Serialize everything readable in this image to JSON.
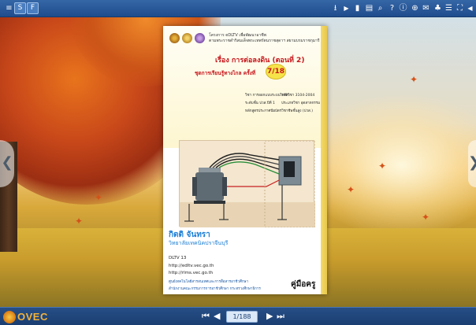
{
  "toolbar": {
    "left_buttons": [
      {
        "icon": "menu-icon",
        "glyph": "≡"
      },
      {
        "icon": "table-of-contents-icon",
        "glyph": "S"
      },
      {
        "icon": "thumbnails-icon",
        "glyph": "F"
      }
    ],
    "right_buttons": [
      {
        "icon": "download-icon",
        "glyph": "⭳"
      },
      {
        "icon": "play-icon",
        "glyph": "▶"
      },
      {
        "icon": "bookmark-icon",
        "glyph": "▮"
      },
      {
        "icon": "print-icon",
        "glyph": "▤"
      },
      {
        "icon": "search-icon",
        "glyph": "⌕"
      },
      {
        "icon": "help-icon",
        "glyph": "?"
      },
      {
        "icon": "info-icon",
        "glyph": "ⓘ"
      },
      {
        "icon": "zoom-icon",
        "glyph": "⊕"
      },
      {
        "icon": "email-icon",
        "glyph": "✉"
      },
      {
        "icon": "share-icon",
        "glyph": "♣"
      },
      {
        "icon": "list-icon",
        "glyph": "☰"
      },
      {
        "icon": "fullscreen-icon",
        "glyph": "⛶"
      },
      {
        "icon": "sound-icon",
        "glyph": "◀"
      }
    ]
  },
  "navigation": {
    "prev_page_glyph": "❮",
    "next_page_glyph": "❯",
    "first_glyph": "⏮",
    "prev_glyph": "◀",
    "next_glyph": "▶",
    "last_glyph": "⏭",
    "current_page": "1/188"
  },
  "logo": {
    "text": "OVEC"
  },
  "book": {
    "org_line_1": "โครงการ eDLTV เพื่อพัฒนาอาชีพ",
    "org_line_2": "ตามพระราชดำริสมเด็จพระเทพรัตนราชสุดาฯ สยามบรมราชกุมารี",
    "lesson_title": "เรื่อง การต่อลงดิน (ตอนที่ 2)",
    "lesson_set": "ชุดการเรียนรู้ทางไกล ครั้งที่",
    "lesson_number": "7/18",
    "info_left": [
      "วิชา การออกแบบระบบไฟฟ้า",
      "ระดับชั้น ปวส.ปีที่ 1",
      "หลักสูตรประกาศนียบัตรวิชาชีพชั้นสูง (ปวส.)"
    ],
    "info_right": [
      "รหัสวิชา 3104-2004",
      "ประเภทวิชา อุตสาหกรรม",
      "สาขาวิชาช่างไฟฟ้ากำลัง"
    ],
    "author": "กิตติ จันทรา",
    "college": "วิทยาลัยเทคนิคปราจีนบุรี",
    "dltv": "DLTV 13",
    "url_1": "http://edltv.vec.go.th",
    "url_2": "http://rlms.vec.go.th",
    "footer_org_1": "ศูนย์เทคโนโลยีสารสนเทศและการสื่อสารอาชีวศึกษา",
    "footer_org_2": "สำนักงานคณะกรรมการการอาชีวศึกษา กระทรวงศึกษาธิการ",
    "guide_label": "คู่มือครู"
  }
}
